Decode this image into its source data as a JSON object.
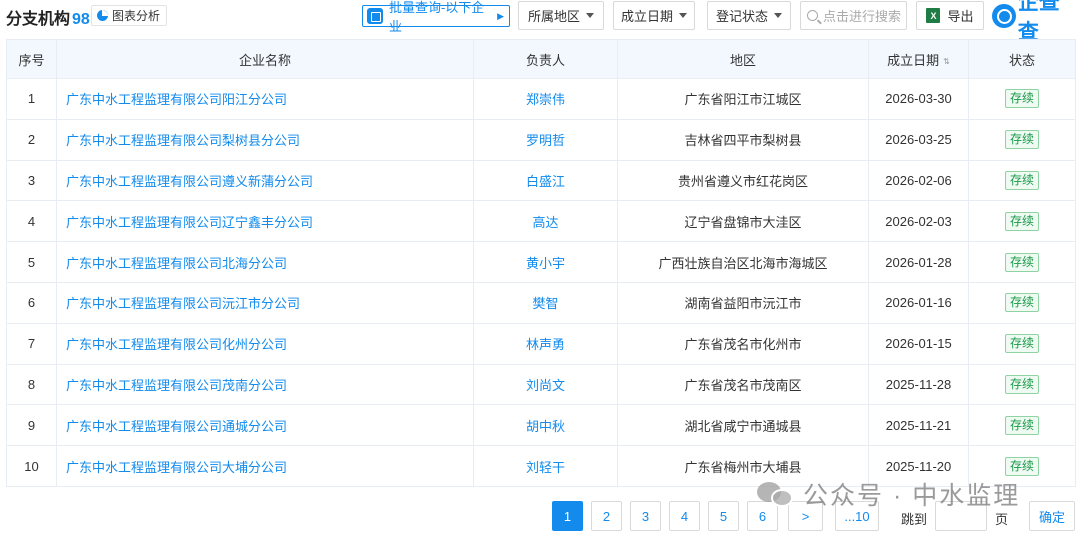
{
  "header": {
    "title": "分支机构",
    "count": "98",
    "chart_button": "图表分析",
    "batch_button": "批量查询-以下企业",
    "filters": {
      "region": "所属地区",
      "established": "成立日期",
      "reg_status": "登记状态"
    },
    "search_placeholder": "点击进行搜索",
    "export_label": "导出",
    "brand": "企查查"
  },
  "table": {
    "headers": {
      "idx": "序号",
      "name": "企业名称",
      "person": "负责人",
      "region": "地区",
      "date": "成立日期",
      "status": "状态"
    },
    "date_sort_icon": "⇅",
    "rows": [
      {
        "idx": "1",
        "name": "广东中水工程监理有限公司阳江分公司",
        "person": "郑崇伟",
        "region": "广东省阳江市江城区",
        "date": "2026-03-30",
        "status": "存续"
      },
      {
        "idx": "2",
        "name": "广东中水工程监理有限公司梨树县分公司",
        "person": "罗明哲",
        "region": "吉林省四平市梨树县",
        "date": "2026-03-25",
        "status": "存续"
      },
      {
        "idx": "3",
        "name": "广东中水工程监理有限公司遵义新蒲分公司",
        "person": "白盛江",
        "region": "贵州省遵义市红花岗区",
        "date": "2026-02-06",
        "status": "存续"
      },
      {
        "idx": "4",
        "name": "广东中水工程监理有限公司辽宁鑫丰分公司",
        "person": "高达",
        "region": "辽宁省盘锦市大洼区",
        "date": "2026-02-03",
        "status": "存续"
      },
      {
        "idx": "5",
        "name": "广东中水工程监理有限公司北海分公司",
        "person": "黄小宇",
        "region": "广西壮族自治区北海市海城区",
        "date": "2026-01-28",
        "status": "存续"
      },
      {
        "idx": "6",
        "name": "广东中水工程监理有限公司沅江市分公司",
        "person": "樊智",
        "region": "湖南省益阳市沅江市",
        "date": "2026-01-16",
        "status": "存续"
      },
      {
        "idx": "7",
        "name": "广东中水工程监理有限公司化州分公司",
        "person": "林声勇",
        "region": "广东省茂名市化州市",
        "date": "2026-01-15",
        "status": "存续"
      },
      {
        "idx": "8",
        "name": "广东中水工程监理有限公司茂南分公司",
        "person": "刘尚文",
        "region": "广东省茂名市茂南区",
        "date": "2025-11-28",
        "status": "存续"
      },
      {
        "idx": "9",
        "name": "广东中水工程监理有限公司通城分公司",
        "person": "胡中秋",
        "region": "湖北省咸宁市通城县",
        "date": "2025-11-21",
        "status": "存续"
      },
      {
        "idx": "10",
        "name": "广东中水工程监理有限公司大埔分公司",
        "person": "刘轻干",
        "region": "广东省梅州市大埔县",
        "date": "2025-11-20",
        "status": "存续"
      }
    ]
  },
  "pagination": {
    "pages": [
      "1",
      "2",
      "3",
      "4",
      "5",
      "6"
    ],
    "current": "1",
    "next": ">",
    "last": "...10",
    "jump_label": "跳到",
    "page_unit": "页",
    "confirm": "确定"
  },
  "watermark": {
    "text": "公众号 · 中水监理"
  },
  "colors": {
    "accent": "#128bed",
    "status_green": "#1a9a48",
    "header_bg": "#f2f8fe"
  }
}
